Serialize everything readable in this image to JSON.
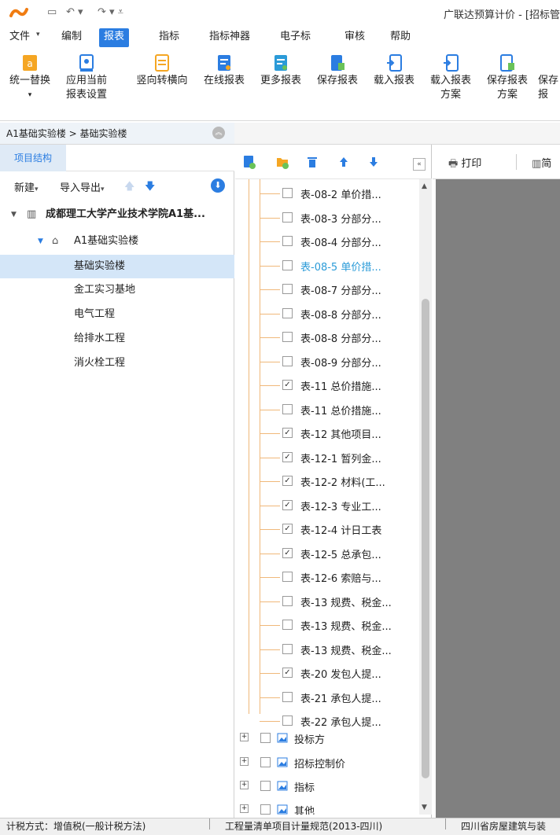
{
  "app": {
    "title": "广联达预算计价 - [招标管"
  },
  "menu": {
    "items": [
      "文件",
      "编制",
      "报表",
      "指标",
      "指标神器",
      "电子标",
      "审核",
      "帮助"
    ],
    "active": "报表"
  },
  "ribbon": {
    "btn1_l1": "统一替换",
    "btn1_l2": "▾",
    "btn2_l1": "应用当前",
    "btn2_l2": "报表设置",
    "btn3": "竖向转横向",
    "btn4": "在线报表",
    "btn5": "更多报表",
    "btn6": "保存报表",
    "btn7": "载入报表",
    "btn8_l1": "载入报表",
    "btn8_l2": "方案",
    "btn9_l1": "保存报表",
    "btn9_l2": "方案",
    "btn10_l1": "保存",
    "btn10_l2": "报"
  },
  "breadcrumb": {
    "text": "A1基础实验楼 > 基础实验楼"
  },
  "left": {
    "tab": "项目结构",
    "new_label": "新建",
    "import_export_label": "导入导出",
    "tree": {
      "root": "成都理工大学产业技术学院A1基...",
      "child": "A1基础实验楼",
      "items": [
        "基础实验楼",
        "金工实习基地",
        "电气工程",
        "给排水工程",
        "消火栓工程"
      ]
    }
  },
  "reports": {
    "items": [
      {
        "label": "表-08-2 单价措...",
        "checked": false
      },
      {
        "label": "表-08-3 分部分...",
        "checked": false
      },
      {
        "label": "表-08-4 分部分...",
        "checked": false
      },
      {
        "label": "表-08-5 单价措...",
        "checked": false
      },
      {
        "label": "表-08-7 分部分...",
        "checked": false
      },
      {
        "label": "表-08-8 分部分...",
        "checked": false
      },
      {
        "label": "表-08-8 分部分...",
        "checked": false
      },
      {
        "label": "表-08-9 分部分...",
        "checked": false
      },
      {
        "label": "表-11 总价措施...",
        "checked": true
      },
      {
        "label": "表-11 总价措施...",
        "checked": false
      },
      {
        "label": "表-12 其他项目...",
        "checked": true
      },
      {
        "label": "表-12-1 暂列金...",
        "checked": true
      },
      {
        "label": "表-12-2 材料(工...",
        "checked": true
      },
      {
        "label": "表-12-3 专业工...",
        "checked": true
      },
      {
        "label": "表-12-4 计日工表",
        "checked": true
      },
      {
        "label": "表-12-5 总承包...",
        "checked": true
      },
      {
        "label": "表-12-6 索赔与...",
        "checked": false
      },
      {
        "label": "表-13 规费、税金...",
        "checked": false
      },
      {
        "label": "表-13 规费、税金...",
        "checked": false
      },
      {
        "label": "表-13 规费、税金...",
        "checked": false
      },
      {
        "label": "表-20 发包人提...",
        "checked": true
      },
      {
        "label": "表-21 承包人提...",
        "checked": false
      },
      {
        "label": "表-22 承包人提...",
        "checked": false
      }
    ],
    "groups": [
      "投标方",
      "招标控制价",
      "指标",
      "其他"
    ]
  },
  "preview": {
    "print_label": "打印",
    "simple_label": "简"
  },
  "status": {
    "tax": "计税方式：增值税(一般计税方法)",
    "rule": "工程量清单项目计量规范(2013-四川)",
    "std": "四川省房屋建筑与装"
  },
  "colors": {
    "accent": "#2b7de1",
    "tree_line": "#f0b87a",
    "preview_bg": "#808080"
  }
}
